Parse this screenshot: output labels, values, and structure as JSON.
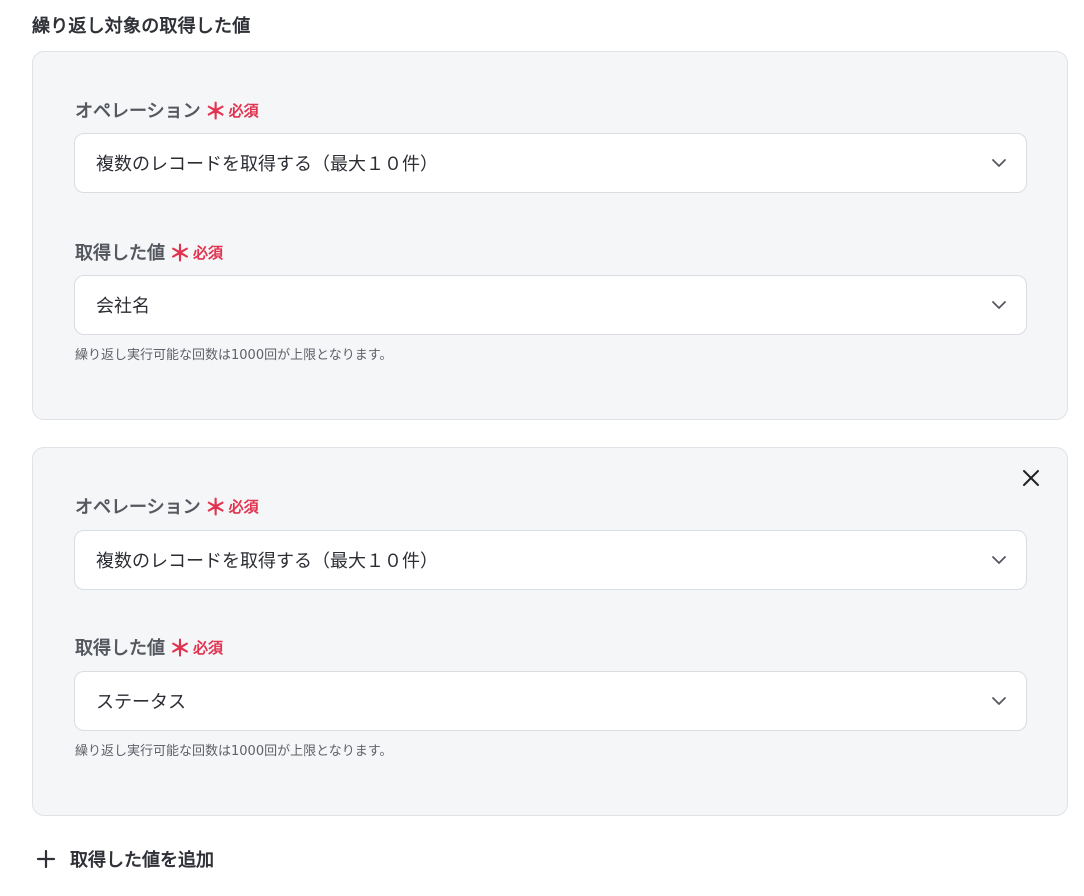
{
  "section_title": "繰り返し対象の取得した値",
  "required_mark": "＊",
  "required_text": "必須",
  "groups": [
    {
      "operation_label": "オペレーション",
      "operation_value": "複数のレコードを取得する（最大１０件）",
      "value_label": "取得した値",
      "value_value": "会社名",
      "hint": "繰り返し実行可能な回数は1000回が上限となります。",
      "removable": false
    },
    {
      "operation_label": "オペレーション",
      "operation_value": "複数のレコードを取得する（最大１０件）",
      "value_label": "取得した値",
      "value_value": "ステータス",
      "hint": "繰り返し実行可能な回数は1000回が上限となります。",
      "removable": true
    }
  ],
  "add_button_label": "取得した値を追加",
  "colors": {
    "required": "#e1334f",
    "card_bg": "#f5f6f8",
    "border": "#dfe2e7"
  }
}
